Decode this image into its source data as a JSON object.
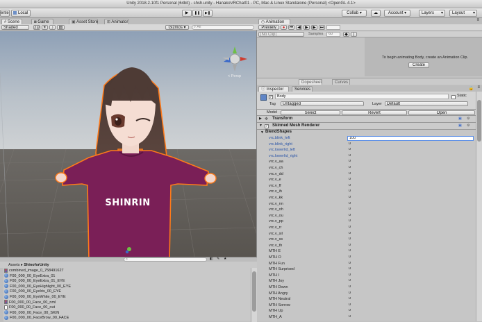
{
  "window": {
    "title": "Unity 2018.2.10f1 Personal (64bit) - shsh.unity - HanakoVRChat01 - PC, Mac & Linux Standalone (Personal) <OpenGL 4.1>"
  },
  "toolbar": {
    "center_label": "enter",
    "local_label": "Local",
    "play_glyph": "▶",
    "pause_glyph": "❚❚",
    "step_glyph": "▶❚",
    "collab_label": "Collab ▾",
    "account_label": "Account ▾",
    "layers_label": "Layers",
    "layout_label": "Layout"
  },
  "scene_tabs": [
    {
      "label": "Scene",
      "icon": "scene-icon"
    },
    {
      "label": "Game",
      "icon": "game-icon"
    },
    {
      "label": "Asset Store",
      "icon": "asset-store-icon"
    },
    {
      "label": "Animator",
      "icon": "animator-icon"
    }
  ],
  "scene_toolbar": {
    "shading": "Shaded",
    "gizmos": "Gizmos ▾",
    "search_placeholder": "All"
  },
  "scene_view": {
    "gizmo_label": "< Persp",
    "shirt_text": "SHINRIN"
  },
  "animation": {
    "tab_label": "Animation",
    "preview_label": "Preview",
    "clip_placeholder": "[No Clip]",
    "samples_label": "Samples",
    "samples_value": "60",
    "message": "To begin animating Body, create an Animation Clip.",
    "create_label": "Create",
    "dopesheet_label": "Dopesheet",
    "curves_label": "Curves"
  },
  "inspector": {
    "tab_label": "Inspector",
    "services_label": "Services",
    "object_name": "Body",
    "static_label": "Static",
    "tag_label": "Tag",
    "tag_value": "Untagged",
    "layer_label": "Layer",
    "layer_value": "Default",
    "model_label": "Model",
    "select_label": "Select",
    "revert_label": "Revert",
    "open_label": "Open",
    "transform_label": "Transform",
    "smr_label": "Skinned Mesh Renderer",
    "blendshapes_label": "BlendShapes",
    "blendshapes": [
      {
        "name": "vrc.blink_left",
        "value": "100"
      },
      {
        "name": "vrc.blink_right",
        "value": "0"
      },
      {
        "name": "vrc.lowerlid_left",
        "value": "0"
      },
      {
        "name": "vrc.lowerlid_right",
        "value": "0"
      },
      {
        "name": "vrc.v_aa",
        "value": "0"
      },
      {
        "name": "vrc.v_ch",
        "value": "0"
      },
      {
        "name": "vrc.v_dd",
        "value": "0"
      },
      {
        "name": "vrc.v_e",
        "value": "0"
      },
      {
        "name": "vrc.v_ff",
        "value": "0"
      },
      {
        "name": "vrc.v_ih",
        "value": "0"
      },
      {
        "name": "vrc.v_kk",
        "value": "0"
      },
      {
        "name": "vrc.v_nn",
        "value": "0"
      },
      {
        "name": "vrc.v_oh",
        "value": "0"
      },
      {
        "name": "vrc.v_ou",
        "value": "0"
      },
      {
        "name": "vrc.v_pp",
        "value": "0"
      },
      {
        "name": "vrc.v_rr",
        "value": "0"
      },
      {
        "name": "vrc.v_sil",
        "value": "0"
      },
      {
        "name": "vrc.v_ss",
        "value": "0"
      },
      {
        "name": "vrc.v_th",
        "value": "0"
      },
      {
        "name": "MTH E",
        "value": "0"
      },
      {
        "name": "MTH O",
        "value": "0"
      },
      {
        "name": "MTH Fun",
        "value": "0"
      },
      {
        "name": "MTH Surprised",
        "value": "0"
      },
      {
        "name": "MTH I",
        "value": "0"
      },
      {
        "name": "MTH Joy",
        "value": "0"
      },
      {
        "name": "MTH Down",
        "value": "0"
      },
      {
        "name": "MTH Angry",
        "value": "0"
      },
      {
        "name": "MTH Neutral",
        "value": "0"
      },
      {
        "name": "MTH Sorrow",
        "value": "0"
      },
      {
        "name": "MTH Up",
        "value": "0"
      },
      {
        "name": "MTH_A",
        "value": "0"
      }
    ]
  },
  "project": {
    "breadcrumb_root": "Assets",
    "breadcrumb_sep": "▸",
    "breadcrumb_folder": "ShinoforUnity",
    "assets": [
      {
        "name": "combined_image_0_758491627",
        "icon": "texture-icon"
      },
      {
        "name": "F00_000_00_EyeExtra_01",
        "icon": "material-icon"
      },
      {
        "name": "F00_000_00_EyeExtra_01_EYE",
        "icon": "material-icon"
      },
      {
        "name": "F00_000_00_EyeHighlight_00_EYE",
        "icon": "material-icon"
      },
      {
        "name": "F00_000_00_EyeIris_00_EYE",
        "icon": "material-icon"
      },
      {
        "name": "F00_000_00_EyeWhite_00_EYE",
        "icon": "material-icon"
      },
      {
        "name": "F00_000_00_Face_00_nml",
        "icon": "texture-icon"
      },
      {
        "name": "F00_000_00_Face_00_out",
        "icon": "document-icon"
      },
      {
        "name": "F00_000_00_Face_00_SKIN",
        "icon": "material-icon"
      },
      {
        "name": "F00_000_00_FaceBrow_00_FACE",
        "icon": "material-icon"
      }
    ]
  },
  "colors": {
    "accent": "#3d7be0",
    "selection_outline": "#ff7a1a",
    "shirt": "#7a1f57"
  }
}
